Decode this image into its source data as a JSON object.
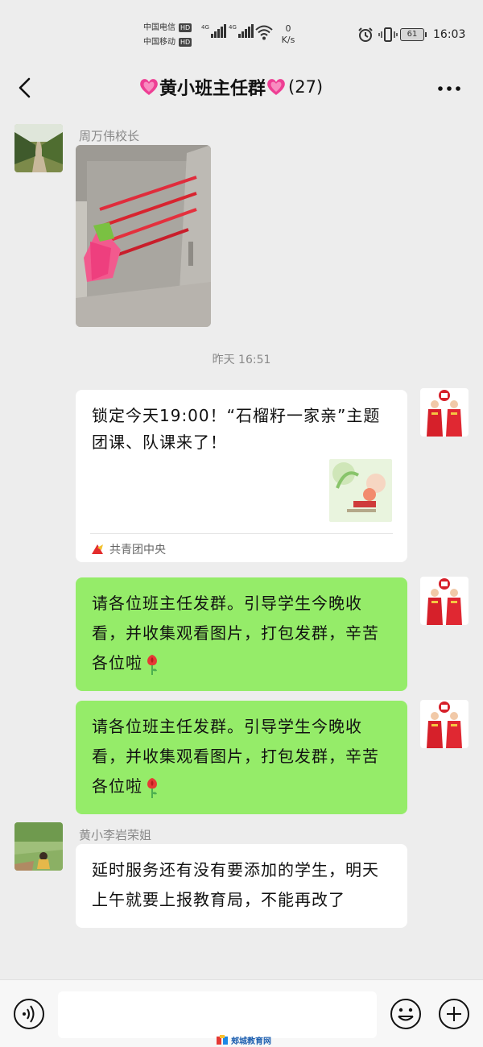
{
  "status_bar": {
    "carrier_1": "中国电信",
    "carrier_2": "中国移动",
    "hd_badge": "HD",
    "network_1": "4G",
    "network_2": "4G",
    "speed_value": "0",
    "speed_unit": "K/s",
    "battery": "61",
    "time": "16:03"
  },
  "header": {
    "title": "黄小班主任群",
    "member_count": "(27)"
  },
  "messages": {
    "m1": {
      "sender": "周万伟校长"
    },
    "timestamp": "昨天 16:51",
    "m2_card": {
      "text": "锁定今天19:00！“石榴籽一家亲”主题团课、队课来了！",
      "source": "共青团中央"
    },
    "m3": {
      "text": "请各位班主任发群。引导学生今晚收看，并收集观看图片，打包发群，辛苦各位啦"
    },
    "m4": {
      "text": "请各位班主任发群。引导学生今晚收看，并收集观看图片，打包发群，辛苦各位啦"
    },
    "m5": {
      "sender": "黄小李岩荣姐",
      "text": "延时服务还有没有要添加的学生，明天上午就要上报教育局，不能再改了"
    }
  },
  "input_bar": {
    "placeholder": ""
  },
  "watermark": {
    "text": "郏城教育网"
  },
  "colors": {
    "background": "#ededed",
    "bubble_self": "#95ec69",
    "bubble_other": "#ffffff",
    "heart": "#e8338a"
  }
}
